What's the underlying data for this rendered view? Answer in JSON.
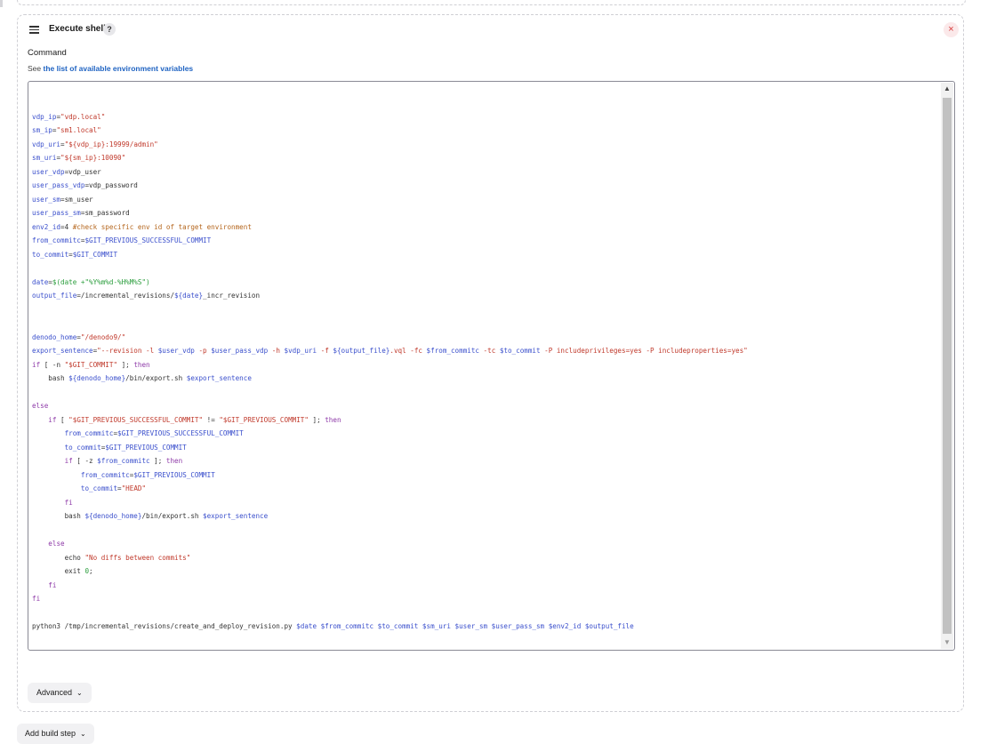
{
  "step": {
    "title": "Execute shell",
    "help": "?",
    "close": "×"
  },
  "command": {
    "label": "Command",
    "env_prefix": "See",
    "env_link": "the list of available environment variables"
  },
  "editor": {
    "lines": [
      [],
      [
        [
          "v",
          "vdp_ip"
        ],
        [
          "p",
          "="
        ],
        [
          "s",
          "\"vdp.local\""
        ]
      ],
      [
        [
          "v",
          "sm_ip"
        ],
        [
          "p",
          "="
        ],
        [
          "s",
          "\"sm1.local\""
        ]
      ],
      [
        [
          "v",
          "vdp_uri"
        ],
        [
          "p",
          "="
        ],
        [
          "s",
          "\"${vdp_ip}:19999/admin\""
        ]
      ],
      [
        [
          "v",
          "sm_uri"
        ],
        [
          "p",
          "="
        ],
        [
          "s",
          "\"${sm_ip}:10090\""
        ]
      ],
      [
        [
          "v",
          "user_vdp"
        ],
        [
          "p",
          "=vdp_user"
        ]
      ],
      [
        [
          "v",
          "user_pass_vdp"
        ],
        [
          "p",
          "=vdp_password"
        ]
      ],
      [
        [
          "v",
          "user_sm"
        ],
        [
          "p",
          "=sm_user"
        ]
      ],
      [
        [
          "v",
          "user_pass_sm"
        ],
        [
          "p",
          "=sm_password"
        ]
      ],
      [
        [
          "v",
          "env2_id"
        ],
        [
          "p",
          "=4 "
        ],
        [
          "c",
          "#check specific env id of target environment"
        ]
      ],
      [
        [
          "v",
          "from_commitc"
        ],
        [
          "p",
          "="
        ],
        [
          "v",
          "$GIT_PREVIOUS_SUCCESSFUL_COMMIT"
        ]
      ],
      [
        [
          "v",
          "to_commit"
        ],
        [
          "p",
          "="
        ],
        [
          "v",
          "$GIT_COMMIT"
        ]
      ],
      [],
      [
        [
          "v",
          "date"
        ],
        [
          "p",
          "="
        ],
        [
          "g",
          "$(date +\"%Y%m%d-%H%M%S\")"
        ]
      ],
      [
        [
          "v",
          "output_file"
        ],
        [
          "p",
          "=/incremental_revisions/"
        ],
        [
          "v",
          "${date}"
        ],
        [
          "p",
          "_incr_revision"
        ]
      ],
      [],
      [],
      [
        [
          "v",
          "denodo_home"
        ],
        [
          "p",
          "="
        ],
        [
          "s",
          "\"/denodo9/\""
        ]
      ],
      [
        [
          "v",
          "export_sentence"
        ],
        [
          "p",
          "="
        ],
        [
          "s",
          "\"--revision -l "
        ],
        [
          "v",
          "$user_vdp"
        ],
        [
          "s",
          " -p "
        ],
        [
          "v",
          "$user_pass_vdp"
        ],
        [
          "s",
          " -h "
        ],
        [
          "v",
          "$vdp_uri"
        ],
        [
          "s",
          " -f "
        ],
        [
          "v",
          "${output_file}"
        ],
        [
          "s",
          ".vql -fc "
        ],
        [
          "v",
          "$from_commitc"
        ],
        [
          "s",
          " -tc "
        ],
        [
          "v",
          "$to_commit"
        ],
        [
          "s",
          " -P includeprivileges=yes -P includeproperties=yes\""
        ]
      ],
      [
        [
          "k",
          "if"
        ],
        [
          "p",
          " [ -n "
        ],
        [
          "s",
          "\"$GIT_COMMIT\""
        ],
        [
          "p",
          " ]; "
        ],
        [
          "k",
          "then"
        ]
      ],
      [
        [
          "p",
          "    bash "
        ],
        [
          "v",
          "${denodo_home}"
        ],
        [
          "p",
          "/bin/export.sh "
        ],
        [
          "v",
          "$export_sentence"
        ]
      ],
      [],
      [
        [
          "k",
          "else"
        ]
      ],
      [
        [
          "p",
          "    "
        ],
        [
          "k",
          "if"
        ],
        [
          "p",
          " [ "
        ],
        [
          "s",
          "\"$GIT_PREVIOUS_SUCCESSFUL_COMMIT\""
        ],
        [
          "p",
          " != "
        ],
        [
          "s",
          "\"$GIT_PREVIOUS_COMMIT\""
        ],
        [
          "p",
          " ]; "
        ],
        [
          "k",
          "then"
        ]
      ],
      [
        [
          "p",
          "        "
        ],
        [
          "v",
          "from_commitc"
        ],
        [
          "p",
          "="
        ],
        [
          "v",
          "$GIT_PREVIOUS_SUCCESSFUL_COMMIT"
        ]
      ],
      [
        [
          "p",
          "        "
        ],
        [
          "v",
          "to_commit"
        ],
        [
          "p",
          "="
        ],
        [
          "v",
          "$GIT_PREVIOUS_COMMIT"
        ]
      ],
      [
        [
          "p",
          "        "
        ],
        [
          "k",
          "if"
        ],
        [
          "p",
          " [ -z "
        ],
        [
          "v",
          "$from_commitc"
        ],
        [
          "p",
          " ]; "
        ],
        [
          "k",
          "then"
        ]
      ],
      [
        [
          "p",
          "            "
        ],
        [
          "v",
          "from_commitc"
        ],
        [
          "p",
          "="
        ],
        [
          "v",
          "$GIT_PREVIOUS_COMMIT"
        ]
      ],
      [
        [
          "p",
          "            "
        ],
        [
          "v",
          "to_commit"
        ],
        [
          "p",
          "="
        ],
        [
          "s",
          "\"HEAD\""
        ]
      ],
      [
        [
          "p",
          "        "
        ],
        [
          "k",
          "fi"
        ]
      ],
      [
        [
          "p",
          "        bash "
        ],
        [
          "v",
          "${denodo_home}"
        ],
        [
          "p",
          "/bin/export.sh "
        ],
        [
          "v",
          "$export_sentence"
        ]
      ],
      [],
      [
        [
          "p",
          "    "
        ],
        [
          "k",
          "else"
        ]
      ],
      [
        [
          "p",
          "        echo "
        ],
        [
          "s",
          "\"No diffs between commits\""
        ]
      ],
      [
        [
          "p",
          "        exit "
        ],
        [
          "g",
          "0"
        ],
        [
          "p",
          ";"
        ]
      ],
      [
        [
          "p",
          "    "
        ],
        [
          "k",
          "fi"
        ]
      ],
      [
        [
          "k",
          "fi"
        ]
      ],
      [],
      [
        [
          "p",
          "python3 /tmp/incremental_revisions/create_and_deploy_revision.py "
        ],
        [
          "v",
          "$date"
        ],
        [
          "p",
          " "
        ],
        [
          "v",
          "$from_commitc"
        ],
        [
          "p",
          " "
        ],
        [
          "v",
          "$to_commit"
        ],
        [
          "p",
          " "
        ],
        [
          "v",
          "$sm_uri"
        ],
        [
          "p",
          " "
        ],
        [
          "v",
          "$user_sm"
        ],
        [
          "p",
          " "
        ],
        [
          "v",
          "$user_pass_sm"
        ],
        [
          "p",
          " "
        ],
        [
          "v",
          "$env2_id"
        ],
        [
          "p",
          " "
        ],
        [
          "v",
          "$output_file"
        ]
      ]
    ]
  },
  "icons": {
    "drag": "drag-handle-icon",
    "scroll_up": "▲",
    "scroll_down": "▼",
    "chevron": "chevron-down-icon"
  },
  "advanced": {
    "label": "Advanced"
  },
  "add_step": {
    "label": "Add build step"
  }
}
